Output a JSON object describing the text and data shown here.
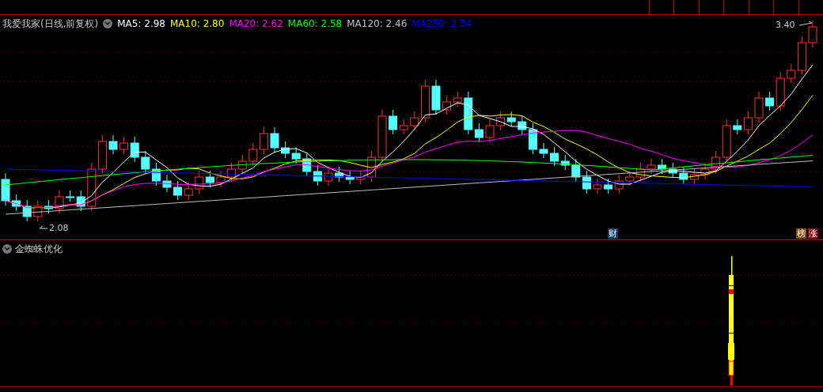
{
  "chart": {
    "title": "我爱我家(日线,前复权)",
    "ma": [
      {
        "text": "MA5: 2.98",
        "color": "#ffffff"
      },
      {
        "text": "MA10: 2.80",
        "color": "#ffff00"
      },
      {
        "text": "MA20: 2.62",
        "color": "#ff00ff"
      },
      {
        "text": "MA60: 2.58",
        "color": "#00ff00"
      },
      {
        "text": "MA120: 2.46",
        "color": "#c0c0c0"
      },
      {
        "text": "MA250: 2.34",
        "color": "#0000ff"
      }
    ],
    "high_label": "3.40",
    "low_label": "2.08",
    "badges": [
      {
        "text": "财",
        "color": "#1a3f6f"
      },
      {
        "text": "榜",
        "color": "#8b4a00"
      },
      {
        "text": "涨",
        "color": "#8b0000"
      }
    ]
  },
  "indicator": {
    "title": "金蜘蛛优化"
  }
}
